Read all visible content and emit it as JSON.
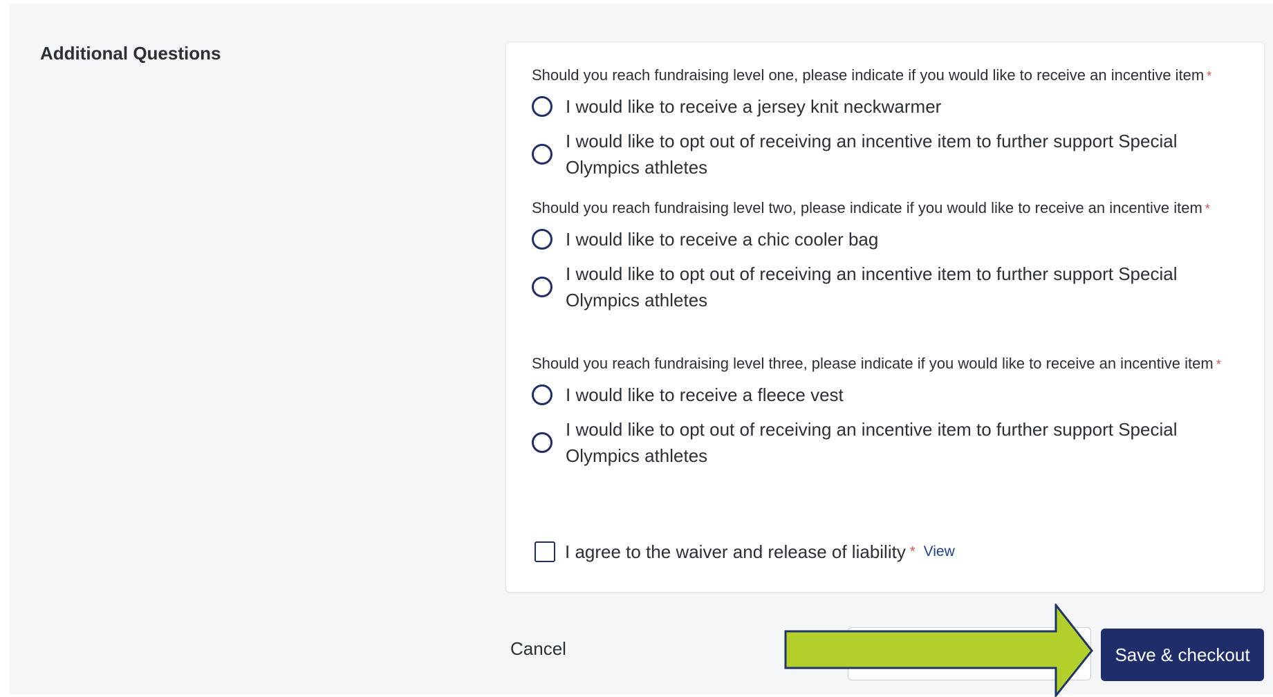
{
  "section": {
    "title": "Additional Questions"
  },
  "questions": [
    {
      "label": "Should you reach fundraising level one, please indicate if you would like to receive an incentive item",
      "required_mark": "*",
      "options": [
        "I would like to receive a jersey knit neckwarmer",
        "I would like to opt out of receiving an incentive item to further support Special Olympics athletes"
      ]
    },
    {
      "label": "Should you reach fundraising level two, please indicate if you would like to receive an incentive item",
      "required_mark": "*",
      "options": [
        "I would like to receive a chic cooler bag",
        "I would like to opt out of receiving an incentive item to further support Special Olympics athletes"
      ]
    },
    {
      "label": "Should you reach fundraising level three, please indicate if you would like to receive an incentive item",
      "required_mark": "*",
      "options": [
        "I would like to receive a fleece vest",
        "I would like to opt out of receiving an incentive item to further support Special Olympics athletes"
      ]
    }
  ],
  "waiver": {
    "label": "I agree to the waiver and release of liability",
    "required_mark": "*",
    "link_label": "View",
    "checked": false
  },
  "actions": {
    "cancel_label": "Cancel",
    "save_label": "Save & checkout"
  },
  "colors": {
    "primary": "#1f2d6b",
    "required": "#d9534f",
    "link": "#1f3f99",
    "annotation_arrow_fill": "#b2cf2c",
    "annotation_arrow_stroke": "#1f3468"
  },
  "icons": {
    "radio": "radio-unselected-icon",
    "checkbox": "checkbox-unchecked-icon",
    "annotation": "arrow-right-icon"
  }
}
